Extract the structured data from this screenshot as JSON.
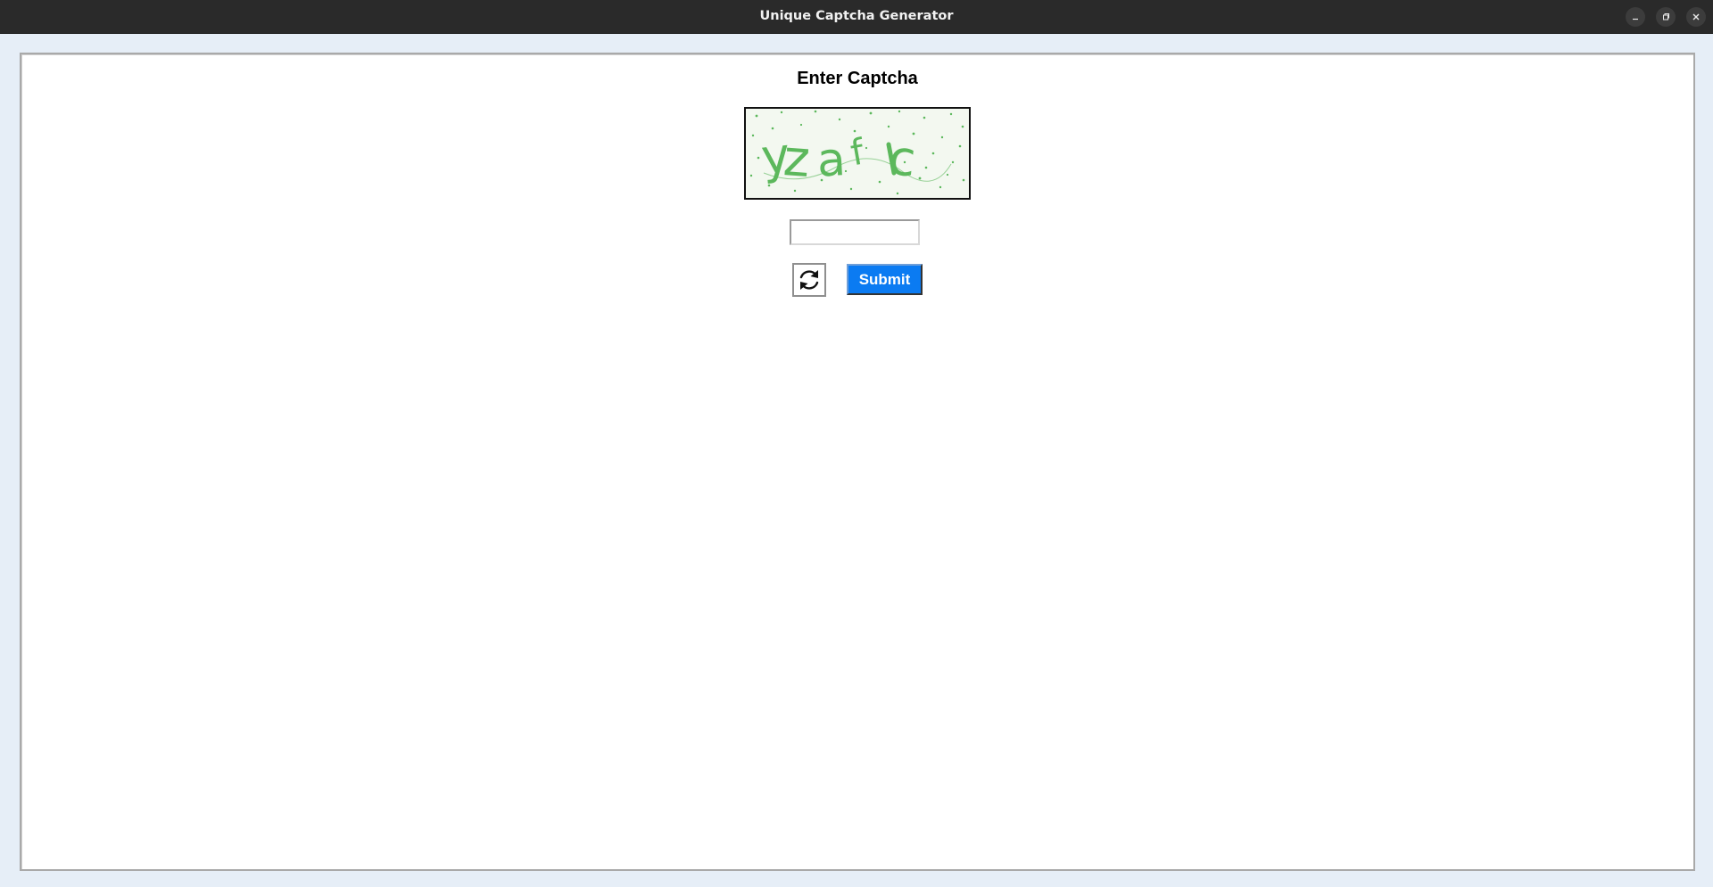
{
  "window": {
    "title": "Unique Captcha Generator",
    "controls": [
      "minimize-icon",
      "maximize-icon",
      "close-icon"
    ]
  },
  "form": {
    "heading": "Enter Captcha",
    "captcha": {
      "text": "yzafc",
      "color": "#5cb85c",
      "background": "#f3f8f0"
    },
    "input_value": "",
    "input_placeholder": "",
    "refresh_icon": "refresh-icon",
    "submit_label": "Submit",
    "submit_color": "#0b7bf2"
  }
}
